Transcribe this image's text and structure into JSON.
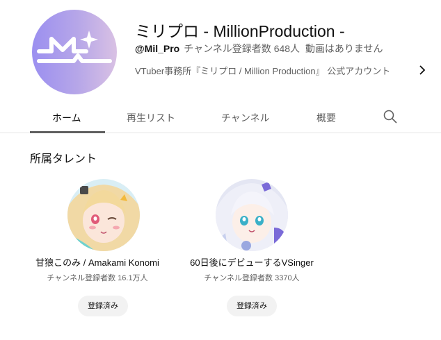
{
  "channel": {
    "name": "ミリプロ - MillionProduction -",
    "handle": "@Mil_Pro",
    "subscribers": "チャンネル登録者数 648人",
    "videos": "動画はありません",
    "description": "VTuber事務所『ミリプロ / Million Production』 公式アカウント",
    "avatar_colors": [
      "#9b8ff0",
      "#d9c1e4"
    ]
  },
  "tabs": [
    {
      "label": "ホーム",
      "active": true
    },
    {
      "label": "再生リスト",
      "active": false
    },
    {
      "label": "チャンネル",
      "active": false
    },
    {
      "label": "概要",
      "active": false
    }
  ],
  "icons": {
    "search": "search-icon",
    "chevron": "chevron-right-icon"
  },
  "section": {
    "title": "所属タレント"
  },
  "talents": [
    {
      "name": "甘狼このみ / Amakami Konomi",
      "subs": "チャンネル登録者数 16.1万人",
      "button": "登録済み"
    },
    {
      "name": "60日後にデビューするVSinger",
      "subs": "チャンネル登録者数 3370人",
      "button": "登録済み"
    }
  ]
}
